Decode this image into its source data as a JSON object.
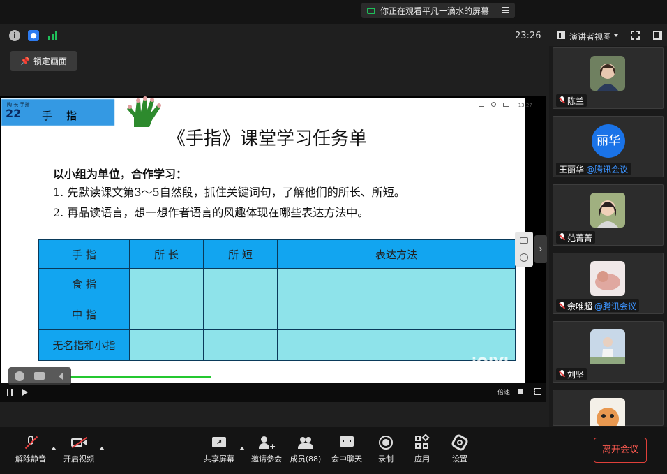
{
  "top_bar": {
    "sharing_notice": "你正在观看平凡一滴水的屏幕",
    "clock": "23:26",
    "view_mode": "演讲者视图"
  },
  "lock_button": {
    "label": "锁定画面"
  },
  "slide": {
    "lesson_number": "22",
    "lesson_title": "手指",
    "lesson_small": "陶 长 手指",
    "title": "《手指》课堂学习任务单",
    "lines": [
      "以小组为单位，合作学习：",
      "1. 先默读课文第3～5自然段，抓住关键词句，了解他们的所长、所短。",
      "2. 再品读语言，想一想作者语言的风趣体现在哪些表达方法中。"
    ],
    "table": {
      "headers": [
        "手 指",
        "所 长",
        "所 短",
        "表达方法"
      ],
      "rows": [
        [
          "食 指",
          "",
          "",
          ""
        ],
        [
          "中 指",
          "",
          "",
          ""
        ],
        [
          "无名指和小指",
          "",
          "",
          ""
        ]
      ]
    },
    "watermark": "iQIYI",
    "player_time": "13:27",
    "player_speed": "倍速"
  },
  "participants": [
    {
      "name": "陈兰",
      "org": "",
      "avatar_type": "photo",
      "avatar_color": "#a08870",
      "muted": true
    },
    {
      "name": "王丽华",
      "org": "@腾讯会议",
      "avatar_type": "text",
      "avatar_text": "丽华",
      "avatar_color": "#1a73e8",
      "muted": false
    },
    {
      "name": "范菁菁",
      "org": "",
      "avatar_type": "photo",
      "avatar_color": "#8a9a6a",
      "muted": true
    },
    {
      "name": "余唯超",
      "org": "@腾讯会议",
      "avatar_type": "photo",
      "avatar_color": "#d8b0a0",
      "muted": true
    },
    {
      "name": "刘坚",
      "org": "",
      "avatar_type": "photo",
      "avatar_color": "#b8c8d8",
      "muted": true
    },
    {
      "name": "",
      "org": "",
      "avatar_type": "photo",
      "avatar_color": "#e0a060",
      "muted": false
    }
  ],
  "bottom_bar": {
    "unmute": "解除静音",
    "video": "开启视频",
    "share": "共享屏幕",
    "invite": "邀请参会",
    "members": "成员(88)",
    "chat": "会中聊天",
    "record": "录制",
    "apps": "应用",
    "settings": "设置",
    "leave": "离开会议"
  },
  "colors": {
    "accent_green": "#1fbf5a",
    "leave_red": "#e0403a",
    "table_header_blue": "#12a5f0",
    "table_cell_cyan": "#8ee3ea",
    "org_blue": "#3d94ff"
  }
}
